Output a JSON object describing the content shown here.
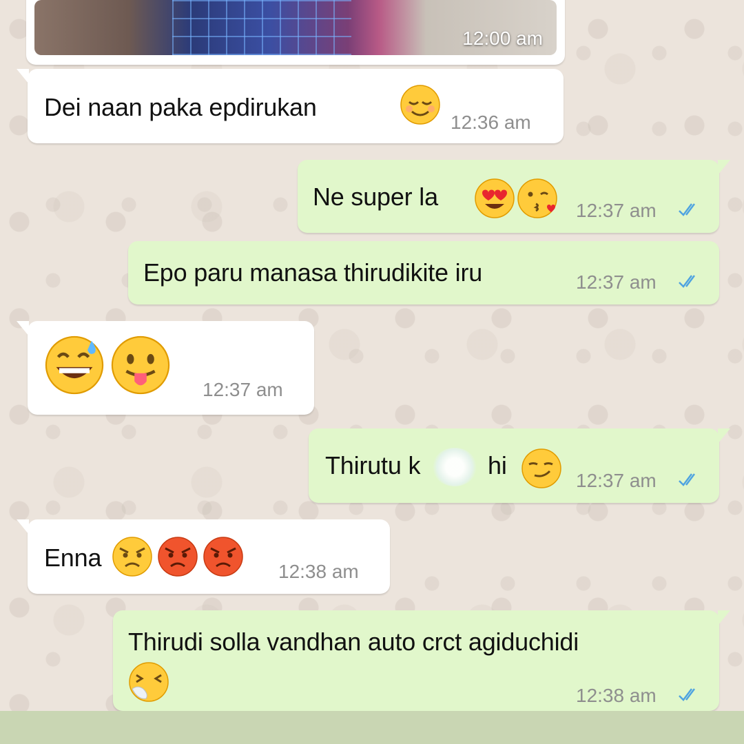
{
  "photo_message": {
    "time": "12:00 am"
  },
  "messages": [
    {
      "text": "Dei naan paka epdirukan",
      "time": "12:36 am",
      "emojis": [
        "relieved-face-icon"
      ]
    },
    {
      "text": "Ne super la",
      "time": "12:37 am",
      "emojis": [
        "heart-eyes-icon",
        "face-blowing-kiss-icon"
      ]
    },
    {
      "text": "Epo paru manasa thirudikite iru",
      "time": "12:37 am",
      "emojis": []
    },
    {
      "text": "",
      "time": "12:37 am",
      "emojis": [
        "grinning-sweat-icon",
        "face-with-tongue-icon"
      ]
    },
    {
      "text": "Thirutu k",
      "text_b": "hi",
      "time": "12:37 am",
      "emojis": [
        "smirking-face-icon"
      ]
    },
    {
      "text": "Enna",
      "time": "12:38 am",
      "emojis": [
        "angry-face-icon",
        "pouting-face-icon",
        "pouting-face-icon"
      ]
    },
    {
      "text": "Thirudi solla vandhan auto crct agiduchidi",
      "time": "12:38 am",
      "emojis": [
        "sneezing-face-icon"
      ]
    }
  ],
  "colors": {
    "incoming_bubble": "#ffffff",
    "outgoing_bubble": "#e1f7cb",
    "read_ticks": "#4fa3e0",
    "wallpaper": "#ece4dc"
  }
}
